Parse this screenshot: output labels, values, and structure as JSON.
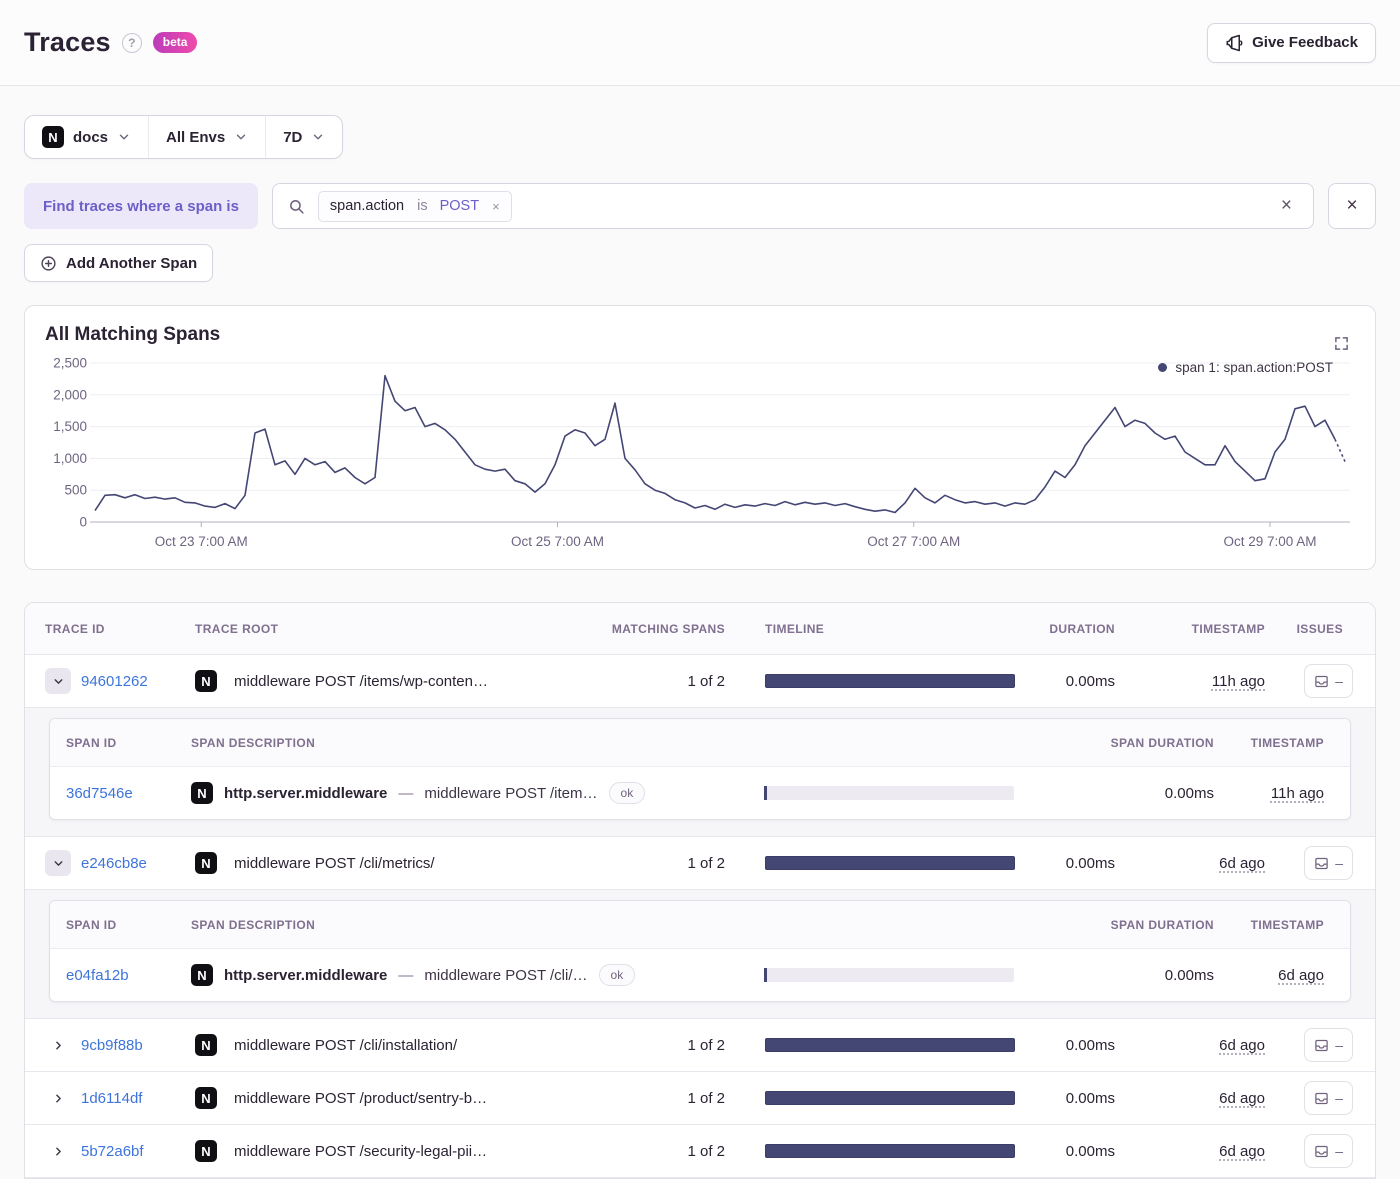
{
  "colors": {
    "chart_line": "#444674",
    "link_blue": "#3D74DB",
    "accent_purple": "#6C5FC7",
    "beta_gradient_start": "#BC3CBA",
    "beta_gradient_end": "#EF4BAB",
    "bar_fill": "#444674"
  },
  "header": {
    "title": "Traces",
    "help_icon": "?",
    "beta_label": "beta",
    "feedback_label": "Give Feedback"
  },
  "filters": {
    "project_icon": "N",
    "project": "docs",
    "environment": "All Envs",
    "date_range": "7D"
  },
  "search": {
    "intro_label": "Find traces where a span is",
    "token_key": "span.action",
    "token_operator": "is",
    "token_value": "POST",
    "token_remove_icon": "×",
    "clear_icon": "×",
    "close_icon": "×",
    "add_span_label": "Add Another Span"
  },
  "chart": {
    "title": "All Matching Spans",
    "legend_label": "span 1: span.action:POST"
  },
  "chart_data": {
    "type": "line",
    "title": "All Matching Spans",
    "legend_position": "top-right",
    "grid": "horizontal",
    "ylim": [
      0,
      2500
    ],
    "ytick_values": [
      0,
      500,
      1000,
      1500,
      2000,
      2500
    ],
    "ytick_labels": [
      "0",
      "500",
      "1,000",
      "1,500",
      "2,000",
      "2,500"
    ],
    "xtick_labels": [
      "Oct 23 7:00 AM",
      "Oct 25 7:00 AM",
      "Oct 27 7:00 AM",
      "Oct 29 7:00 AM"
    ],
    "xtick_fractions": [
      0.085,
      0.37,
      0.655,
      0.94
    ],
    "dashed_tail_points": 1,
    "series": [
      {
        "name": "span 1: span.action:POST",
        "values": [
          180,
          420,
          430,
          380,
          430,
          370,
          390,
          360,
          380,
          310,
          300,
          250,
          230,
          290,
          210,
          420,
          1400,
          1460,
          900,
          960,
          750,
          1000,
          900,
          950,
          780,
          850,
          700,
          600,
          700,
          2300,
          1900,
          1750,
          1800,
          1500,
          1550,
          1450,
          1300,
          1100,
          900,
          830,
          800,
          830,
          650,
          600,
          470,
          600,
          900,
          1350,
          1450,
          1400,
          1200,
          1300,
          1870,
          1000,
          820,
          600,
          500,
          450,
          350,
          300,
          220,
          260,
          200,
          280,
          230,
          270,
          250,
          290,
          260,
          320,
          270,
          310,
          280,
          300,
          260,
          290,
          240,
          200,
          170,
          190,
          150,
          300,
          530,
          380,
          300,
          420,
          350,
          300,
          320,
          280,
          300,
          250,
          300,
          280,
          350,
          550,
          800,
          700,
          900,
          1200,
          1400,
          1600,
          1800,
          1500,
          1600,
          1550,
          1400,
          1300,
          1350,
          1100,
          1000,
          900,
          900,
          1200,
          950,
          800,
          650,
          680,
          1100,
          1300,
          1780,
          1820,
          1500,
          1600,
          1300,
          950
        ]
      }
    ]
  },
  "table": {
    "project_icon": "N",
    "separator": "—",
    "issues_empty": "–",
    "columns": [
      {
        "label": "TRACE ID"
      },
      {
        "label": "TRACE ROOT"
      },
      {
        "label": "MATCHING SPANS"
      },
      {
        "label": "TIMELINE"
      },
      {
        "label": "DURATION"
      },
      {
        "label": "TIMESTAMP"
      },
      {
        "label": "ISSUES"
      }
    ],
    "span_columns": [
      {
        "label": "SPAN ID"
      },
      {
        "label": "SPAN DESCRIPTION"
      },
      {
        "label": ""
      },
      {
        "label": "SPAN DURATION"
      },
      {
        "label": "TIMESTAMP"
      }
    ],
    "rows": [
      {
        "trace_id": "94601262",
        "expanded": true,
        "trace_root": "middleware POST /items/wp-conten…",
        "matching_spans": "1 of 2",
        "duration": "0.00ms",
        "timestamp": "11h ago",
        "spans": [
          {
            "span_id": "36d7546e",
            "operation": "http.server.middleware",
            "description": "middleware POST /item…",
            "status": "ok",
            "duration": "0.00ms",
            "timestamp": "11h ago"
          }
        ]
      },
      {
        "trace_id": "e246cb8e",
        "expanded": true,
        "trace_root": "middleware POST /cli/metrics/",
        "matching_spans": "1 of 2",
        "duration": "0.00ms",
        "timestamp": "6d ago",
        "spans": [
          {
            "span_id": "e04fa12b",
            "operation": "http.server.middleware",
            "description": "middleware POST /cli/…",
            "status": "ok",
            "duration": "0.00ms",
            "timestamp": "6d ago"
          }
        ]
      },
      {
        "trace_id": "9cb9f88b",
        "expanded": false,
        "trace_root": "middleware POST /cli/installation/",
        "matching_spans": "1 of 2",
        "duration": "0.00ms",
        "timestamp": "6d ago",
        "spans": []
      },
      {
        "trace_id": "1d6114df",
        "expanded": false,
        "trace_root": "middleware POST /product/sentry-b…",
        "matching_spans": "1 of 2",
        "duration": "0.00ms",
        "timestamp": "6d ago",
        "spans": []
      },
      {
        "trace_id": "5b72a6bf",
        "expanded": false,
        "trace_root": "middleware POST /security-legal-pii…",
        "matching_spans": "1 of 2",
        "duration": "0.00ms",
        "timestamp": "6d ago",
        "spans": []
      }
    ]
  }
}
